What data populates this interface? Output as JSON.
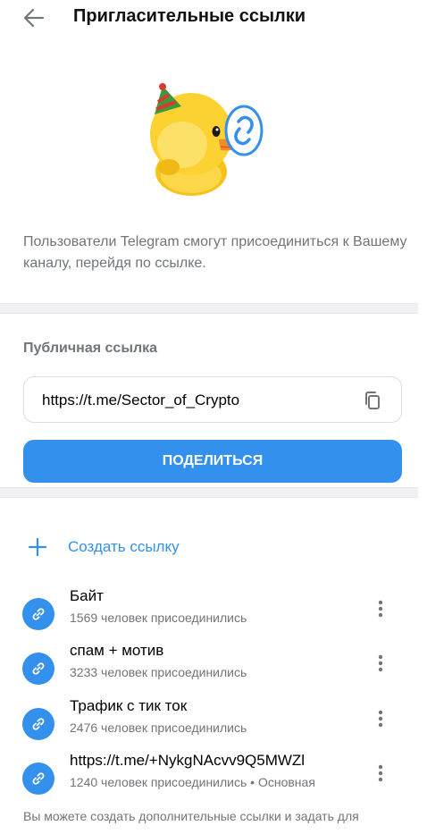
{
  "header": {
    "title": "Пригласительные ссылки"
  },
  "intro": {
    "text": "Пользователи Telegram смогут присоединиться к Вашему каналу, перейдя по ссылке."
  },
  "public_link": {
    "label": "Публичная ссылка",
    "url": "https://t.me/Sector_of_Crypto",
    "share_label": "ПОДЕЛИТЬСЯ"
  },
  "create": {
    "label": "Создать ссылку"
  },
  "links": [
    {
      "title": "Байт",
      "subtitle": "1569 человек присоединились"
    },
    {
      "title": "спам + мотив",
      "subtitle": "3233 человек присоединились"
    },
    {
      "title": "Трафик с тик ток",
      "subtitle": "2476 человек присоединились"
    },
    {
      "title": "https://t.me/+NykgNAcvv9Q5MWZl",
      "subtitle": "1240 человек присоединились • Основная"
    }
  ],
  "footer": {
    "text": "Вы можете создать дополнительные ссылки и задать для"
  },
  "colors": {
    "accent": "#3390ec",
    "secondary_text": "#707579",
    "divider": "#f1f1f4"
  },
  "icons": [
    "back-arrow-icon",
    "duck-sticker",
    "copy-icon",
    "plus-icon",
    "link-icon",
    "more-vertical-icon"
  ]
}
